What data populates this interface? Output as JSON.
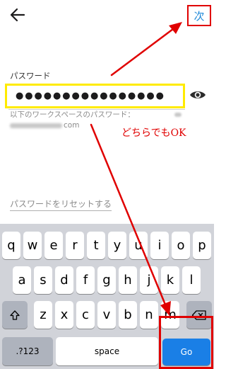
{
  "topbar": {
    "next_label": "次"
  },
  "form": {
    "label": "パスワード",
    "password_masked": "●●●●●●●●●●●●●●●●",
    "helper_text": "以下のワークスペースのパスワード：",
    "helper_email_end": "com",
    "reset_link": "パスワードをリセットする"
  },
  "annotation": {
    "note": "どちらでもOK",
    "color": "#e00000"
  },
  "keyboard": {
    "row1": [
      "q",
      "w",
      "e",
      "r",
      "t",
      "y",
      "u",
      "i",
      "o",
      "p"
    ],
    "row2": [
      "a",
      "s",
      "d",
      "f",
      "g",
      "h",
      "j",
      "k",
      "l"
    ],
    "row3": [
      "z",
      "x",
      "c",
      "v",
      "b",
      "n",
      "m"
    ],
    "numbers_label": ".?123",
    "space_label": "space",
    "go_label": "Go",
    "accent_color": "#1a7fe6"
  },
  "icons": [
    "back-arrow-icon",
    "eye-icon",
    "shift-icon",
    "delete-icon"
  ]
}
